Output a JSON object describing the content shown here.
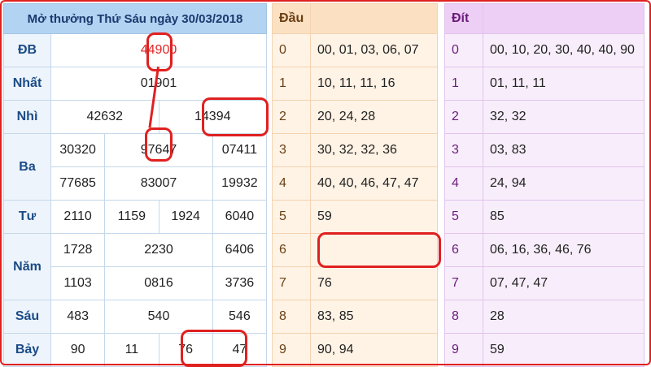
{
  "lottery": {
    "title": "Mở thưởng Thứ Sáu ngày 30/03/2018",
    "rows": [
      {
        "prize": "ĐB",
        "values": [
          [
            "44900"
          ]
        ]
      },
      {
        "prize": "Nhất",
        "values": [
          [
            "01901"
          ]
        ]
      },
      {
        "prize": "Nhì",
        "values": [
          [
            "42632",
            "14394"
          ]
        ]
      },
      {
        "prize": "Ba",
        "values": [
          [
            "30320",
            "97647",
            "07411"
          ],
          [
            "77685",
            "83007",
            "19932"
          ]
        ]
      },
      {
        "prize": "Tư",
        "values": [
          [
            "2110",
            "1159",
            "1924",
            "6040"
          ]
        ]
      },
      {
        "prize": "Năm",
        "values": [
          [
            "1728",
            "2230",
            "6406"
          ],
          [
            "1103",
            "0816",
            "3736"
          ]
        ]
      },
      {
        "prize": "Sáu",
        "values": [
          [
            "483",
            "540",
            "546"
          ]
        ]
      },
      {
        "prize": "Bảy",
        "values": [
          [
            "90",
            "11",
            "76",
            "47"
          ]
        ]
      }
    ]
  },
  "dau": {
    "header": "Đầu",
    "rows": [
      {
        "k": "0",
        "v": "00, 01, 03, 06, 07"
      },
      {
        "k": "1",
        "v": "10, 11, 11, 16"
      },
      {
        "k": "2",
        "v": "20, 24, 28"
      },
      {
        "k": "3",
        "v": "30, 32, 32, 36"
      },
      {
        "k": "4",
        "v": "40, 40, 46, 47, 47"
      },
      {
        "k": "5",
        "v": "59"
      },
      {
        "k": "6",
        "v": ""
      },
      {
        "k": "7",
        "v": "76"
      },
      {
        "k": "8",
        "v": "83, 85"
      },
      {
        "k": "9",
        "v": "90, 94"
      }
    ]
  },
  "dit": {
    "header": "Đít",
    "rows": [
      {
        "k": "0",
        "v": "00, 10, 20, 30, 40, 40, 90"
      },
      {
        "k": "1",
        "v": "01, 11, 11"
      },
      {
        "k": "2",
        "v": "32, 32"
      },
      {
        "k": "3",
        "v": "03, 83"
      },
      {
        "k": "4",
        "v": "24, 94"
      },
      {
        "k": "5",
        "v": "85"
      },
      {
        "k": "6",
        "v": "06, 16, 36, 46, 76"
      },
      {
        "k": "7",
        "v": "07, 47, 47"
      },
      {
        "k": "8",
        "v": "28"
      },
      {
        "k": "9",
        "v": "59"
      }
    ]
  },
  "colors": {
    "annotation": "#e02020",
    "special_prize": "#e02424"
  }
}
